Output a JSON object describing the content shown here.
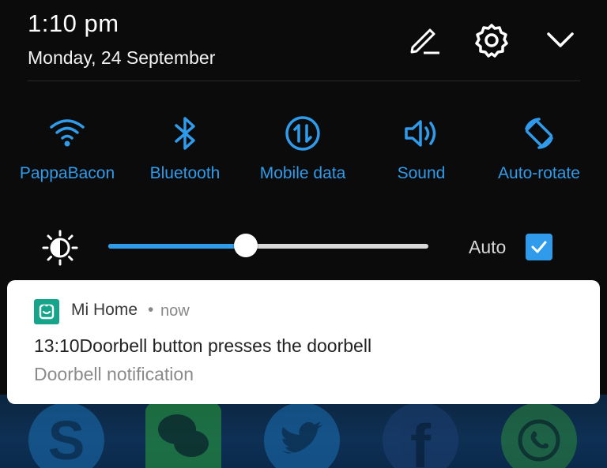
{
  "status": {
    "time": "1:10 pm",
    "date": "Monday, 24 September"
  },
  "header_icons": [
    "edit-icon",
    "settings-icon",
    "collapse-icon"
  ],
  "quick_tiles": [
    {
      "label": "PappaBacon",
      "icon": "wifi-icon"
    },
    {
      "label": "Bluetooth",
      "icon": "bluetooth-icon"
    },
    {
      "label": "Mobile data",
      "icon": "mobile-data-icon"
    },
    {
      "label": "Sound",
      "icon": "sound-icon"
    },
    {
      "label": "Auto-rotate",
      "icon": "auto-rotate-icon"
    }
  ],
  "brightness": {
    "level": 0.43,
    "auto_label": "Auto",
    "auto_checked": true
  },
  "notification": {
    "app_name": "Mi Home",
    "separator": "•",
    "when": "now",
    "title": "13:10Doorbell button presses the doorbell",
    "body": "Doorbell notification"
  },
  "homescreen_apps": [
    "skype-icon",
    "wechat-icon",
    "twitter-icon",
    "facebook-icon",
    "whatsapp-icon"
  ],
  "colors": {
    "accent": "#2f9bea",
    "app_icon": "#16a58a"
  }
}
